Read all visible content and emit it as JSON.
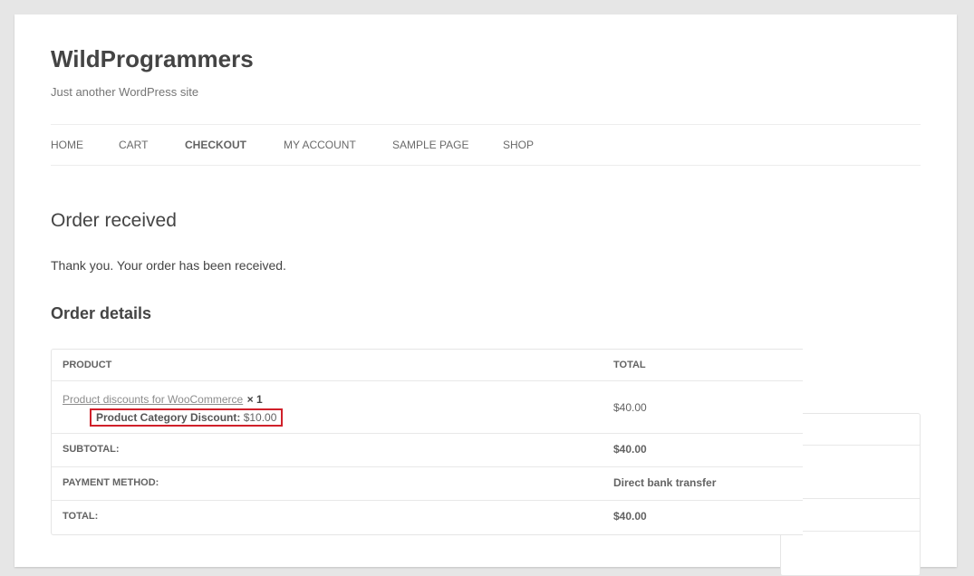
{
  "site": {
    "title": "WildProgrammers",
    "description": "Just another WordPress site"
  },
  "nav": {
    "items": [
      {
        "label": "HOME"
      },
      {
        "label": "CART"
      },
      {
        "label": "CHECKOUT",
        "current": true
      },
      {
        "label": "MY ACCOUNT"
      },
      {
        "label": "SAMPLE PAGE"
      },
      {
        "label": "SHOP"
      }
    ]
  },
  "main": {
    "title": "Order received",
    "thanks": "Thank you. Your order has been received.",
    "details_title": "Order details"
  },
  "table": {
    "headers": {
      "product": "PRODUCT",
      "total": "TOTAL"
    },
    "item": {
      "name": "Product discounts for WooCommerce",
      "qty": "× 1",
      "discount_label": "Product Category Discount:",
      "discount_value": "$10.00",
      "total": "$40.00"
    },
    "subtotal": {
      "label": "SUBTOTAL:",
      "value": "$40.00"
    },
    "payment": {
      "label": "PAYMENT METHOD:",
      "value": "Direct bank transfer"
    },
    "total": {
      "label": "TOTAL:",
      "value": "$40.00"
    }
  },
  "colors": {
    "highlight_border": "#d0202a",
    "background": "#e6e6e6"
  }
}
